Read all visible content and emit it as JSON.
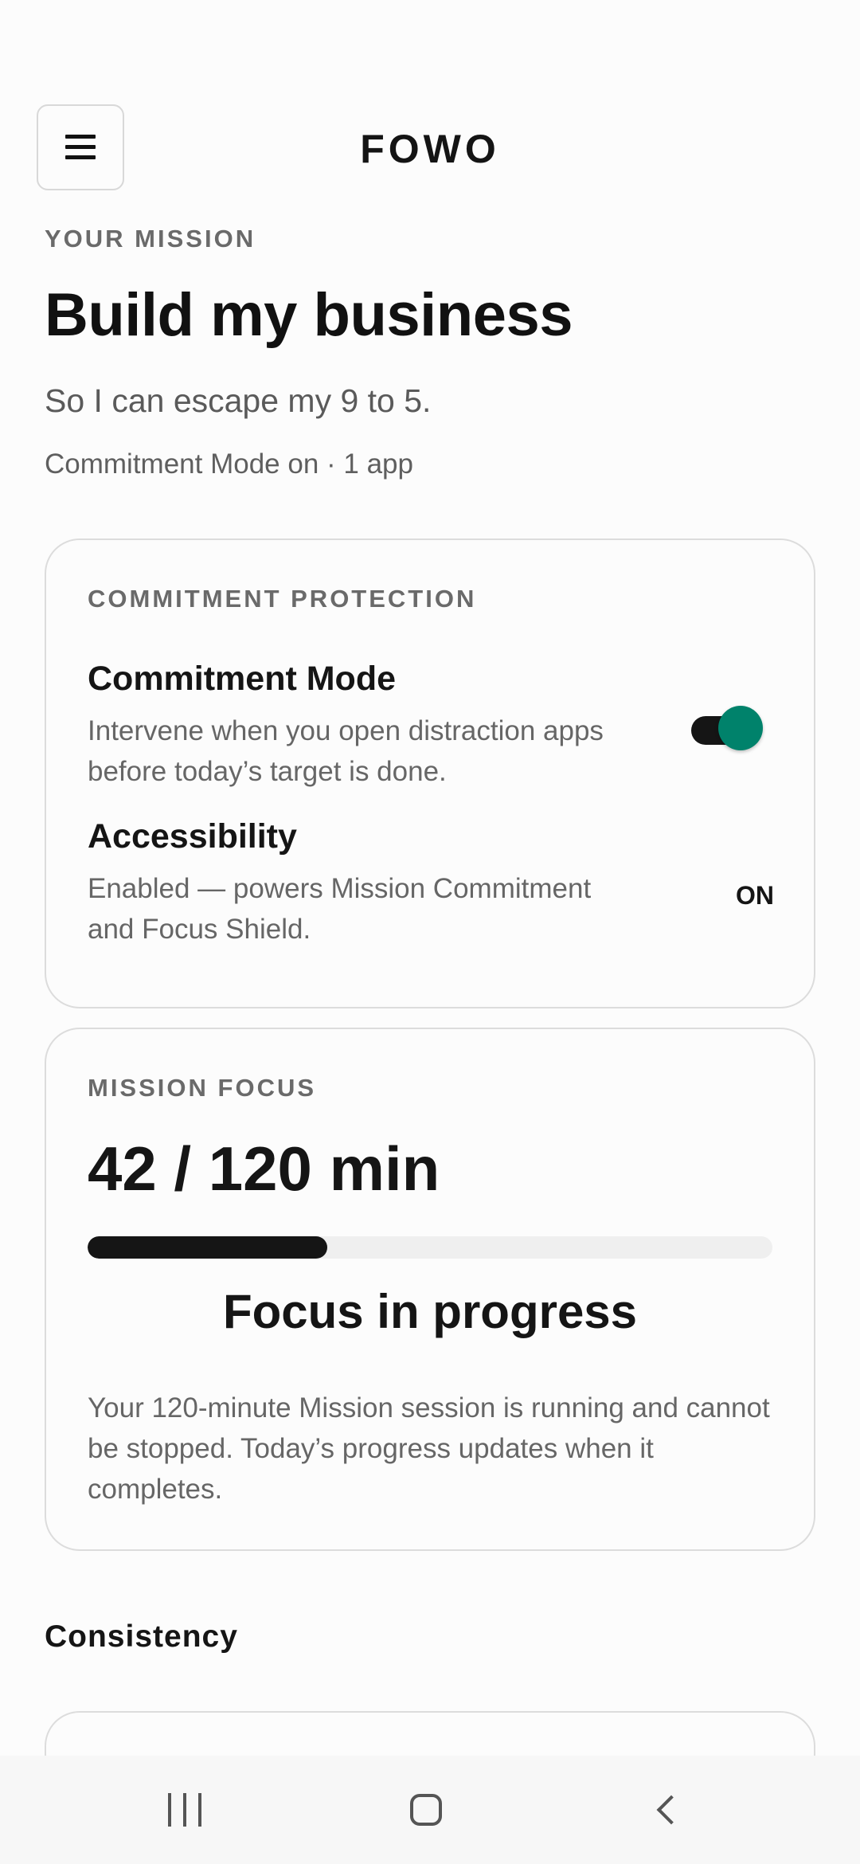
{
  "header": {
    "menu_icon": "hamburger-menu-icon",
    "app_title": "FOWO"
  },
  "mission": {
    "label": "YOUR MISSION",
    "title": "Build my business",
    "subtitle": "So I can escape my 9 to 5.",
    "meta": "Commitment Mode on · 1 app"
  },
  "commitment_protection": {
    "label": "COMMITMENT PROTECTION",
    "commitment_mode": {
      "title": "Commitment Mode",
      "description": "Intervene when you open distraction apps before today’s target is done.",
      "enabled": true
    },
    "accessibility": {
      "title": "Accessibility",
      "description": "Enabled — powers Mission Commitment and Focus Shield.",
      "status": "ON"
    }
  },
  "mission_focus": {
    "label": "MISSION FOCUS",
    "value_text": "42 / 120 min",
    "progress_minutes": 42,
    "target_minutes": 120,
    "status": "Focus in progress",
    "description": "Your 120-minute Mission session is running and cannot be stopped. Today’s progress updates when it completes."
  },
  "consistency": {
    "title": "Consistency"
  },
  "colors": {
    "accent": "#00826b",
    "text_primary": "#151515",
    "text_secondary": "#666666",
    "border": "#dcdcdc"
  },
  "navigation": {
    "recent_icon": "recent-apps-icon",
    "home_icon": "home-icon",
    "back_icon": "back-icon"
  }
}
